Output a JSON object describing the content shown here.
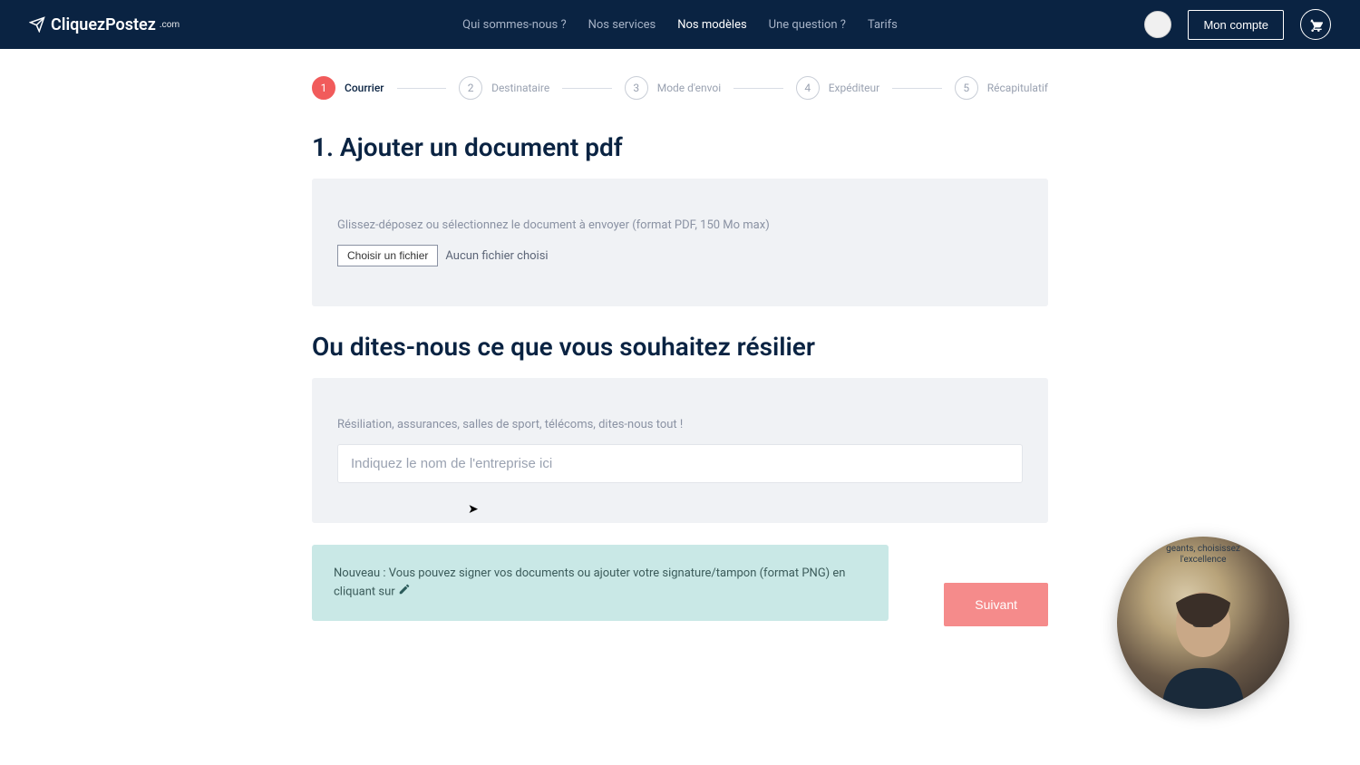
{
  "brand": {
    "name": "CliquezPostez",
    "suffix": ".com"
  },
  "nav": {
    "items": [
      {
        "label": "Qui sommes-nous ?",
        "active": false
      },
      {
        "label": "Nos services",
        "active": false
      },
      {
        "label": "Nos modèles",
        "active": true
      },
      {
        "label": "Une question ?",
        "active": false
      },
      {
        "label": "Tarifs",
        "active": false
      }
    ],
    "account_label": "Mon compte"
  },
  "stepper": {
    "steps": [
      {
        "num": "1",
        "label": "Courrier",
        "active": true
      },
      {
        "num": "2",
        "label": "Destinataire",
        "active": false
      },
      {
        "num": "3",
        "label": "Mode d'envoi",
        "active": false
      },
      {
        "num": "4",
        "label": "Expéditeur",
        "active": false
      },
      {
        "num": "5",
        "label": "Récapitulatif",
        "active": false
      }
    ]
  },
  "upload": {
    "title": "1. Ajouter un document pdf",
    "hint": "Glissez-déposez ou sélectionnez le document à envoyer (format PDF, 150 Mo max)",
    "choose_label": "Choisir un fichier",
    "no_file": "Aucun fichier choisi"
  },
  "cancel": {
    "title": "Ou dites-nous ce que vous souhaitez résilier",
    "hint": "Résiliation, assurances, salles de sport, télécoms, dites-nous tout !",
    "placeholder": "Indiquez le nom de l'entreprise ici"
  },
  "info": {
    "text_prefix": "Nouveau : Vous pouvez signer vos documents ou ajouter votre signature/tampon (format PNG) en cliquant sur "
  },
  "actions": {
    "next": "Suivant"
  },
  "video": {
    "caption": "geants, choisissez l'excellence"
  },
  "colors": {
    "header_bg": "#0a2342",
    "accent": "#f15b5b",
    "accent_soft": "#f58b8b",
    "panel_bg": "#f0f2f5",
    "info_bg": "#c9e8e6"
  }
}
